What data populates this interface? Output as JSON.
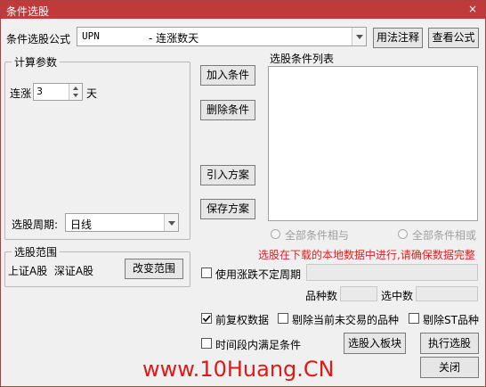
{
  "window": {
    "title": "条件选股",
    "close_glyph": "×"
  },
  "formula": {
    "label": "条件选股公式",
    "code": "UPN",
    "desc": "- 连涨数天",
    "btn_usage": "用法注释",
    "btn_view": "查看公式"
  },
  "calc": {
    "group_title": "计算参数",
    "param_label": "连涨",
    "param_value": "3",
    "param_unit": "天",
    "period_label": "选股周期:",
    "period_value": "日线"
  },
  "actions": {
    "add": "加入条件",
    "delete": "删除条件",
    "import": "引入方案",
    "save": "保存方案"
  },
  "condition_list": {
    "title": "选股条件列表",
    "items": []
  },
  "logic": {
    "and_label": "全部条件相与",
    "or_label": "全部条件相或"
  },
  "notice": {
    "text": "选股在下载的本地数据中进行,请确保数据完整",
    "color": "#e02020"
  },
  "scope": {
    "group_title": "选股范围",
    "selected": "上证A股  深证A股",
    "change_btn": "改变范围"
  },
  "options": {
    "uncertain_period": {
      "label": "使用涨跌不定周期",
      "checked": false
    },
    "count_label": "品种数",
    "selected_label": "选中数",
    "fq": {
      "label": "前复权数据",
      "checked": true
    },
    "exclude_untraded": {
      "label": "剔除当前未交易的品种",
      "checked": false
    },
    "exclude_st": {
      "label": "剔除ST品种",
      "checked": false
    },
    "timespan": {
      "label": "时间段内满足条件",
      "checked": false
    }
  },
  "bottom": {
    "to_block": "选股入板块",
    "execute": "执行选股",
    "close": "关闭"
  },
  "watermark": {
    "text": "www.10Huang.CN",
    "color": "#e01818"
  }
}
